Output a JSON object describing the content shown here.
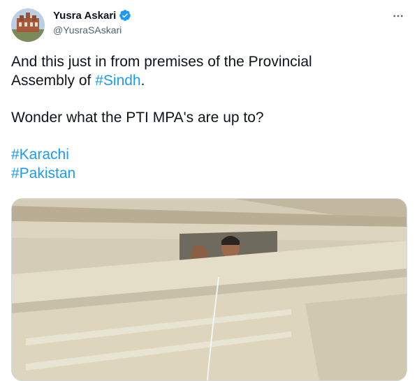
{
  "author": {
    "display_name": "Yusra Askari",
    "handle": "@YusraSAskari",
    "verified": true,
    "verified_color": "#1d9bf0"
  },
  "tweet": {
    "line1_part1": "And this just in from premises of the Provincial",
    "line2_part1": "Assembly of ",
    "hashtag_sindh": "#Sindh",
    "line2_end": ".",
    "line3": "Wonder what the PTI MPA's are up to?",
    "hashtag_karachi": "#Karachi",
    "hashtag_pakistan": "#Pakistan"
  },
  "colors": {
    "link": "#1d9bf0",
    "text": "#0f1419",
    "secondary": "#536471"
  },
  "icons": {
    "more": "more-horizontal-icon",
    "verified": "verified-badge-icon"
  }
}
